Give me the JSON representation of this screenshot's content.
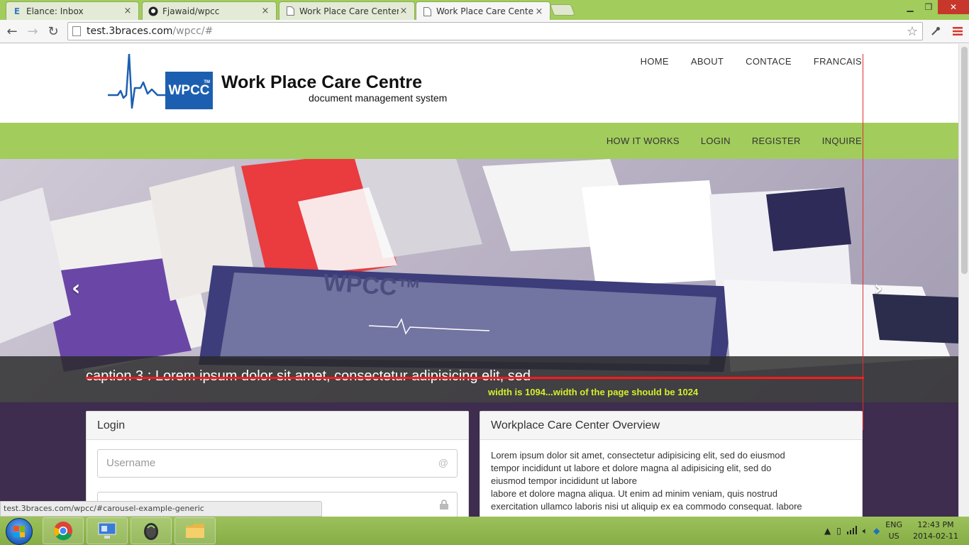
{
  "browser": {
    "tabs": [
      {
        "label": "Elance: Inbox",
        "icon": "elance-icon",
        "active": false
      },
      {
        "label": "Fjawaid/wpcc",
        "icon": "github-icon",
        "active": false
      },
      {
        "label": "Work Place Care Center",
        "icon": "page-icon",
        "active": false
      },
      {
        "label": "Work Place Care Center",
        "icon": "page-icon",
        "active": true
      }
    ],
    "url_host": "test.3braces.com",
    "url_path": "/wpcc/#",
    "status_url": "test.3braces.com/wpcc/#carousel-example-generic"
  },
  "site": {
    "logo_box": "WPCC",
    "logo_tm": "TM",
    "logo_title": "Work Place Care Centre",
    "logo_subtitle": "document management system",
    "top_nav": [
      "HOME",
      "ABOUT",
      "CONTACE",
      "FRANCAIS"
    ],
    "green_nav": [
      "HOW IT WORKS",
      "LOGIN",
      "REGISTER",
      "INQUIRE"
    ],
    "carousel": {
      "caption": "caption 3 : Lorem ipsum dolor sit amet, consectetur adipisicing elit, sed",
      "annotation": "width is 1094...width of the page should be 1024",
      "prev": "‹",
      "next": "›"
    },
    "login": {
      "title": "Login",
      "username_placeholder": "Username",
      "password_placeholder": ""
    },
    "overview": {
      "title": "Workplace Care Center Overview",
      "lines": [
        "Lorem ipsum dolor sit amet, consectetur adipisicing elit, sed do eiusmod",
        "tempor incididunt ut labore et dolore magna al adipisicing elit, sed do",
        "eiusmod tempor incididunt ut labore",
        "labore et dolore magna aliqua. Ut enim ad minim veniam, quis nostrud",
        "exercitation ullamco laboris nisi ut aliquip ex ea commodo consequat. labore"
      ]
    }
  },
  "taskbar": {
    "lang_top": "ENG",
    "lang_bottom": "US",
    "time": "12:43 PM",
    "date": "2014-02-11"
  },
  "colors": {
    "green": "#a2cc5c",
    "purple": "#3e2d4e",
    "brand_blue": "#1c5fb0",
    "annotation": "#d4ef2c",
    "guide_red": "#ff1a1a"
  }
}
